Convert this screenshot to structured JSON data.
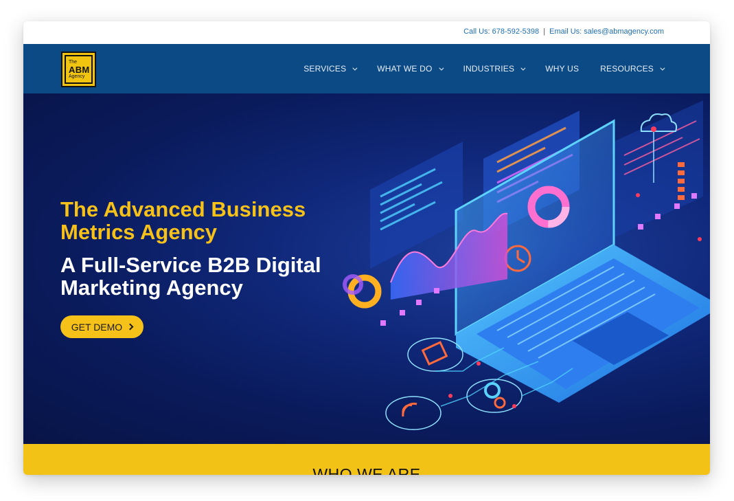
{
  "topbar": {
    "call_label": "Call Us: 678-592-5398",
    "separator": "|",
    "email_label": "Email Us: sales@abmagency.com"
  },
  "logo": {
    "line1": "The",
    "line2": "ABM",
    "line3": "Agency"
  },
  "nav": {
    "items": [
      {
        "label": "SERVICES",
        "has_dropdown": true
      },
      {
        "label": "WHAT WE DO",
        "has_dropdown": true
      },
      {
        "label": "INDUSTRIES",
        "has_dropdown": true
      },
      {
        "label": "WHY US",
        "has_dropdown": false
      },
      {
        "label": "RESOURCES",
        "has_dropdown": true
      }
    ]
  },
  "hero": {
    "headline_primary": "The Advanced Business Metrics Agency",
    "headline_secondary": "A Full-Service B2B Digital Marketing Agency",
    "cta_label": "GET DEMO",
    "illustration": "laptop-data-analytics-icon"
  },
  "section": {
    "title": "WHO WE ARE"
  },
  "colors": {
    "nav_bg": "#0c4a86",
    "accent_yellow": "#f6c21a",
    "hero_bg": "#0a1b5c",
    "link_blue": "#1f6fb0"
  }
}
